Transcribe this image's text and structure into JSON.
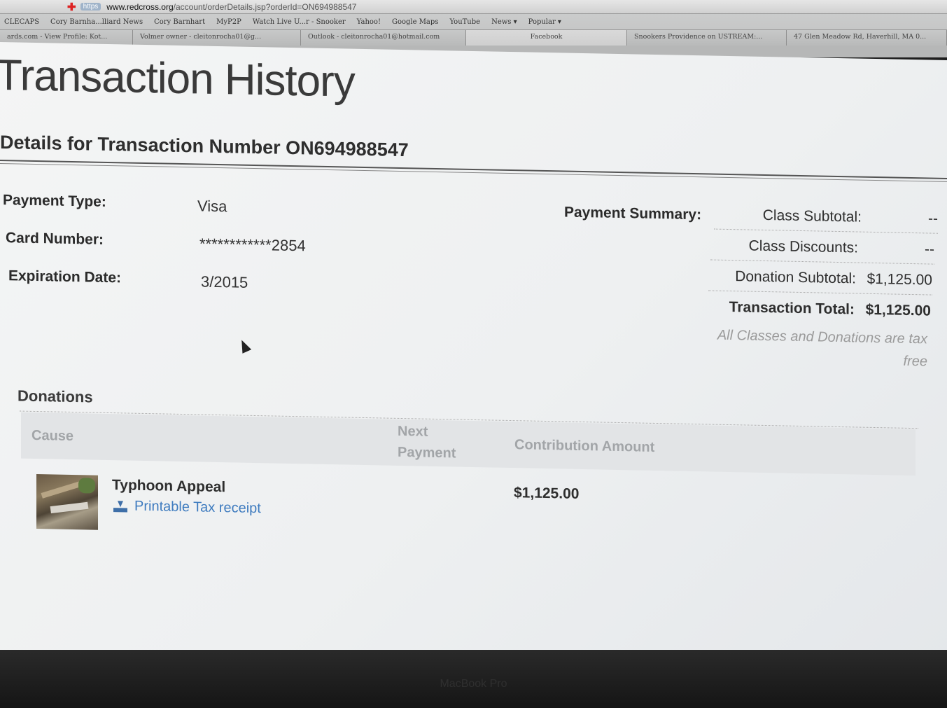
{
  "browser": {
    "url_host": "www.redcross.org",
    "url_path": "/account/orderDetails.jsp?orderId=ON694988547",
    "bookmarks": [
      "CLECAPS",
      "Cory Barnha...lliard News",
      "Cory Barnhart",
      "MyP2P",
      "Watch Live U...r - Snooker",
      "Yahoo!",
      "Google Maps",
      "YouTube",
      "News ▾",
      "Popular ▾"
    ],
    "tabs": [
      "ards.com - View Profile: Kot...",
      "Volmer owner - cleitonrocha01@g...",
      "Outlook - cleitonrocha01@hotmail.com",
      "Facebook",
      "Snookers Providence on USTREAM:...",
      "47 Glen Meadow Rd, Haverhill, MA 0..."
    ]
  },
  "page": {
    "title": "Transaction History",
    "details_title": "Details for Transaction Number ON694988547"
  },
  "payment": {
    "type_label": "Payment Type:",
    "type_value": "Visa",
    "card_label": "Card Number:",
    "card_value": "************2854",
    "exp_label": "Expiration Date:",
    "exp_value": "3/2015"
  },
  "summary": {
    "heading": "Payment Summary:",
    "class_subtotal_label": "Class Subtotal:",
    "class_subtotal_value": "--",
    "class_discounts_label": "Class Discounts:",
    "class_discounts_value": "--",
    "donation_subtotal_label": "Donation Subtotal:",
    "donation_subtotal_value": "$1,125.00",
    "total_label": "Transaction Total:",
    "total_value": "$1,125.00",
    "note": "All Classes and Donations are tax free"
  },
  "donations": {
    "heading": "Donations",
    "columns": {
      "cause": "Cause",
      "next_payment_line1": "Next",
      "next_payment_line2": "Payment",
      "contribution": "Contribution Amount"
    },
    "rows": [
      {
        "cause": "Typhoon Appeal",
        "receipt_link": "Printable Tax receipt",
        "contribution": "$1,125.00"
      }
    ]
  },
  "device": {
    "bezel_label": "MacBook Pro"
  }
}
